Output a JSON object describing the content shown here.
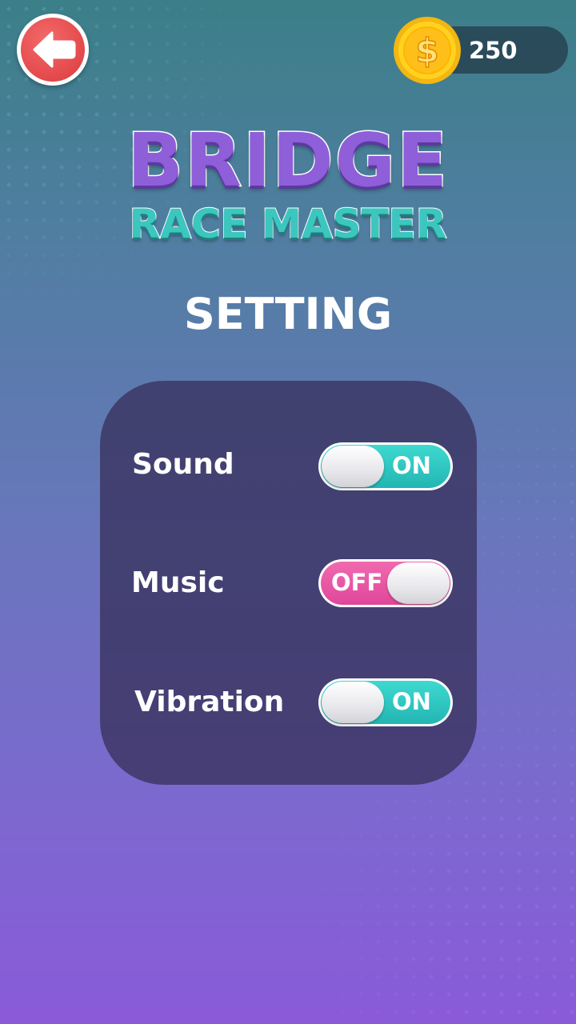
{
  "coins": {
    "value": "250",
    "icon": "coin-icon",
    "symbol": "$"
  },
  "back_button": {
    "icon": "arrow-left-icon"
  },
  "logo": {
    "line1": "BRIDGE",
    "line2": "RACE MASTER"
  },
  "title": "SETTING",
  "settings": [
    {
      "label": "Sound",
      "state": "ON",
      "enabled": true
    },
    {
      "label": "Music",
      "state": "OFF",
      "enabled": false
    },
    {
      "label": "Vibration",
      "state": "ON",
      "enabled": true
    }
  ],
  "colors": {
    "toggle_on": "#22b6b3",
    "toggle_off": "#e0479a",
    "back_button": "#e64d4f",
    "logo_purple": "#8e5fd8",
    "logo_teal": "#3cc6c0"
  }
}
